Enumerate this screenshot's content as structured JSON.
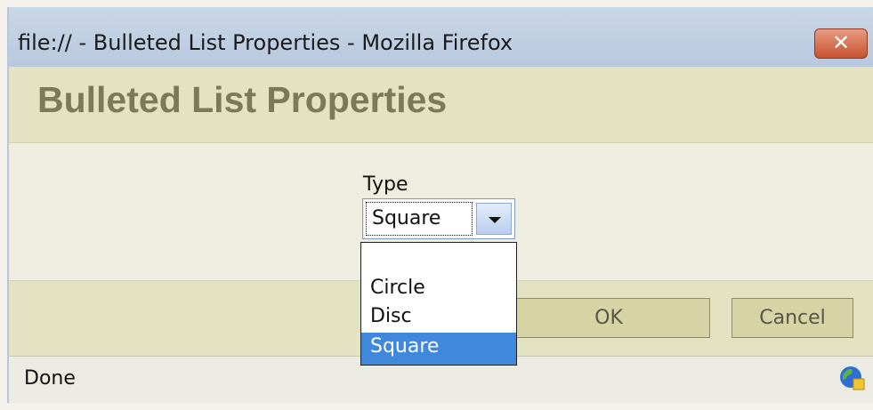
{
  "window": {
    "title": "file:// - Bulleted List Properties - Mozilla Firefox",
    "close_label": "✕"
  },
  "dialog": {
    "title": "Bulleted List Properties",
    "type_label": "Type",
    "selected_value": "Square",
    "dropdown_options": [
      "",
      "Circle",
      "Disc",
      "Square"
    ],
    "highlighted_option": "Square"
  },
  "buttons": {
    "ok": "OK",
    "cancel": "Cancel"
  },
  "status": {
    "text": "Done"
  },
  "icons": {
    "close": "close-icon",
    "dropdown": "chevron-down-icon",
    "status": "globe-icon"
  },
  "colors": {
    "header_bg": "#e3e3c4",
    "title_text": "#7a7a5b",
    "selection": "#3f88dc",
    "close_red": "#c8522f"
  }
}
